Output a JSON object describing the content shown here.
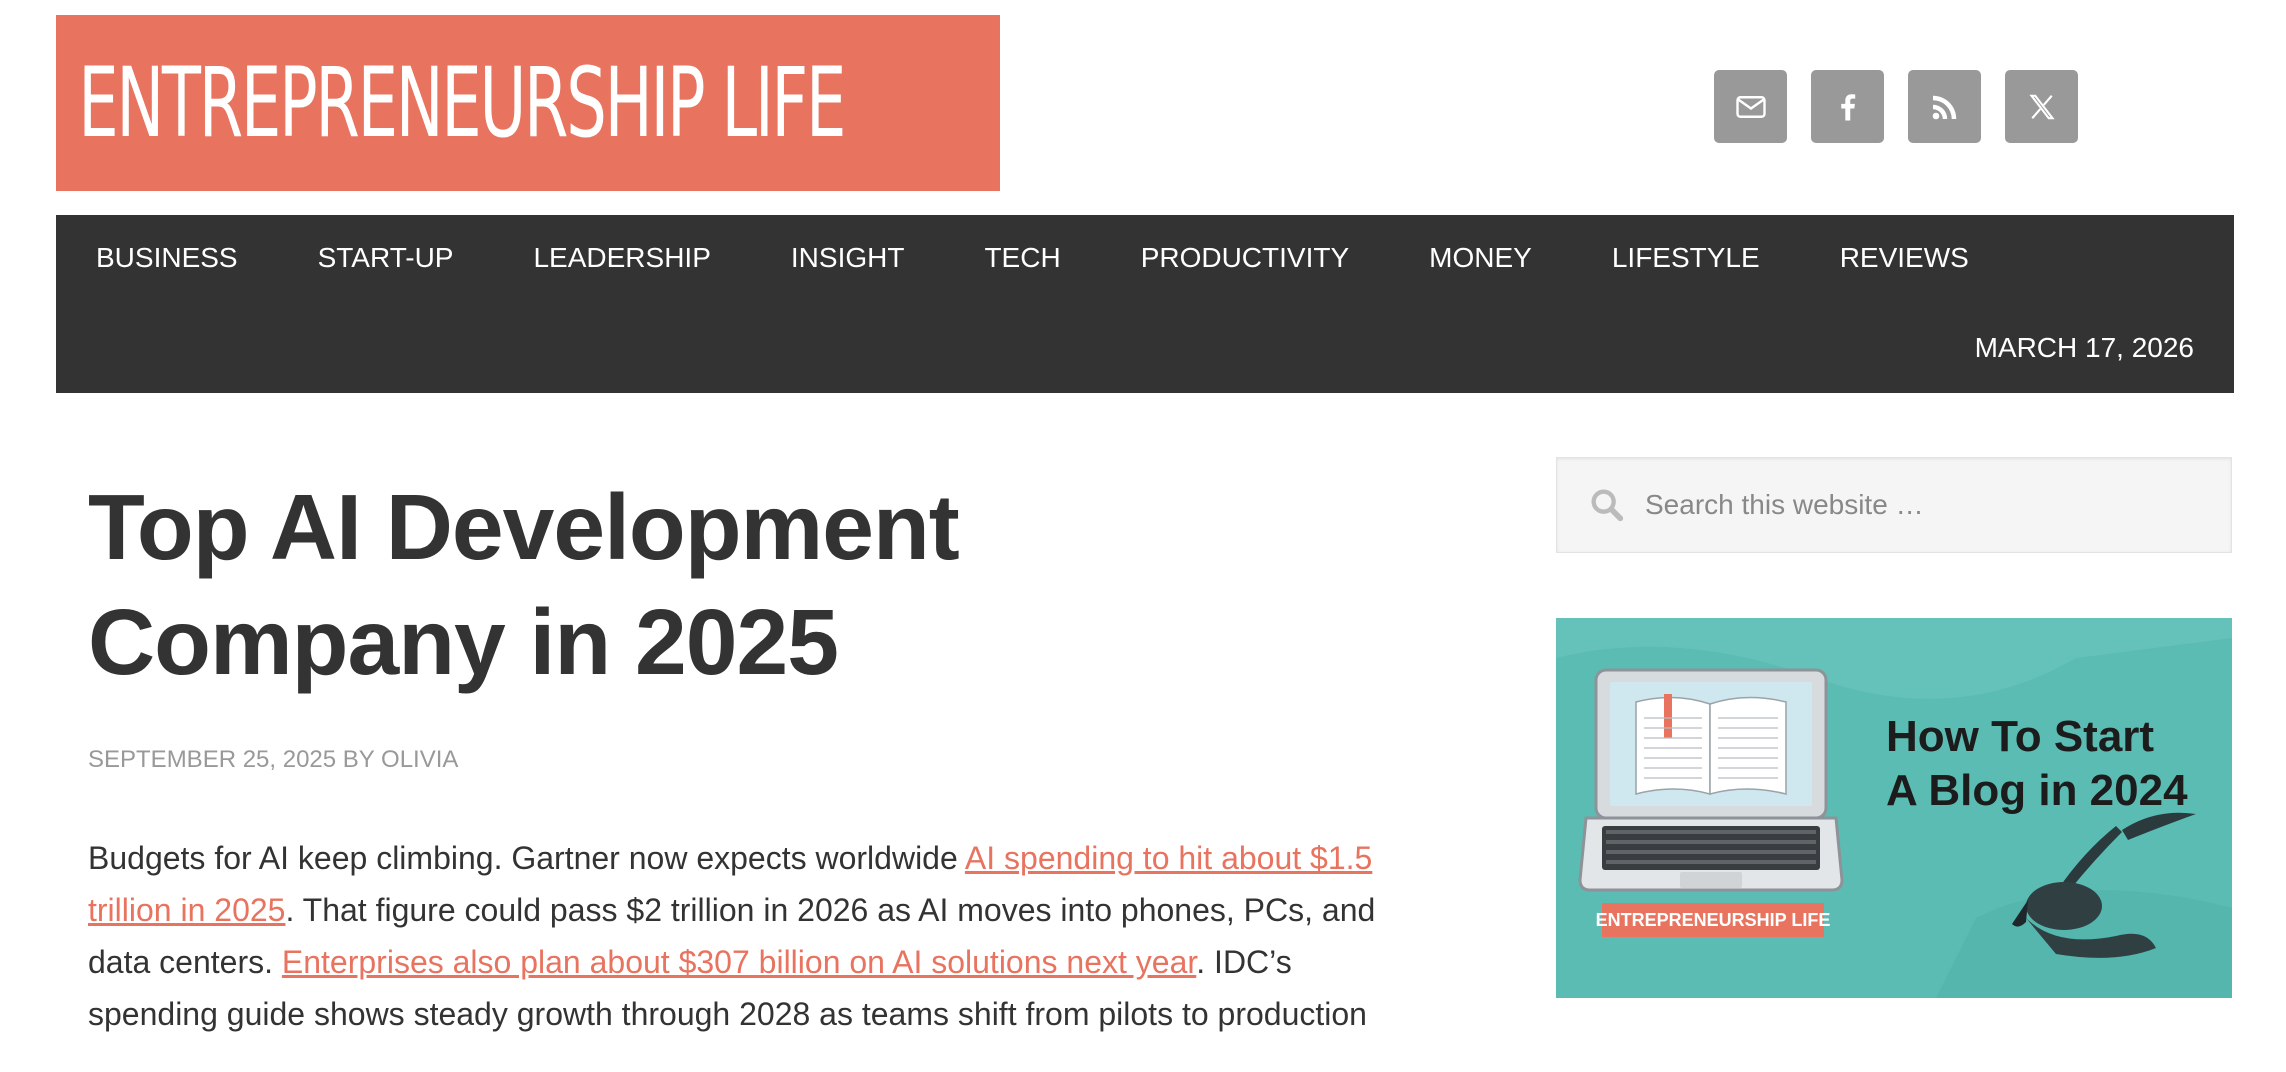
{
  "site": {
    "logo_text": "ENTREPRENEURSHIP LIFE"
  },
  "social": [
    {
      "icon": "email-icon",
      "label": "Email"
    },
    {
      "icon": "facebook-icon",
      "label": "Facebook"
    },
    {
      "icon": "rss-icon",
      "label": "RSS"
    },
    {
      "icon": "x-twitter-icon",
      "label": "X"
    }
  ],
  "nav": {
    "items": [
      "BUSINESS",
      "START-UP",
      "LEADERSHIP",
      "INSIGHT",
      "TECH",
      "PRODUCTIVITY",
      "MONEY",
      "LIFESTYLE",
      "REVIEWS"
    ],
    "date": "MARCH 17, 2026"
  },
  "article": {
    "title_line1": "Top AI Development",
    "title_line2": "Company in 2025",
    "meta": "SEPTEMBER 25, 2025 BY OLIVIA",
    "p1_text1": "Budgets for AI keep climbing. Gartner now expects worldwide ",
    "p1_link1": "AI spending to hit about $1.5 trillion in 2025",
    "p1_text2": ". That figure could pass $2 trillion in 2026 as AI moves into phones, PCs, and data centers. ",
    "p1_link2": "Enterprises also plan about $307 billion on AI solutions next year",
    "p1_text3": ". IDC’s spending guide shows steady growth through 2028 as teams shift from pilots to production"
  },
  "sidebar": {
    "search_placeholder": "Search this website …",
    "banner_title_line1": "How To Start",
    "banner_title_line2": "A Blog in 2024",
    "banner_tag": "ENTREPRENEURSHIP LIFE"
  },
  "colors": {
    "brand": "#e8735f",
    "nav_bg": "#333333",
    "social_bg": "#999999",
    "banner_bg": "#5bbcb4"
  }
}
